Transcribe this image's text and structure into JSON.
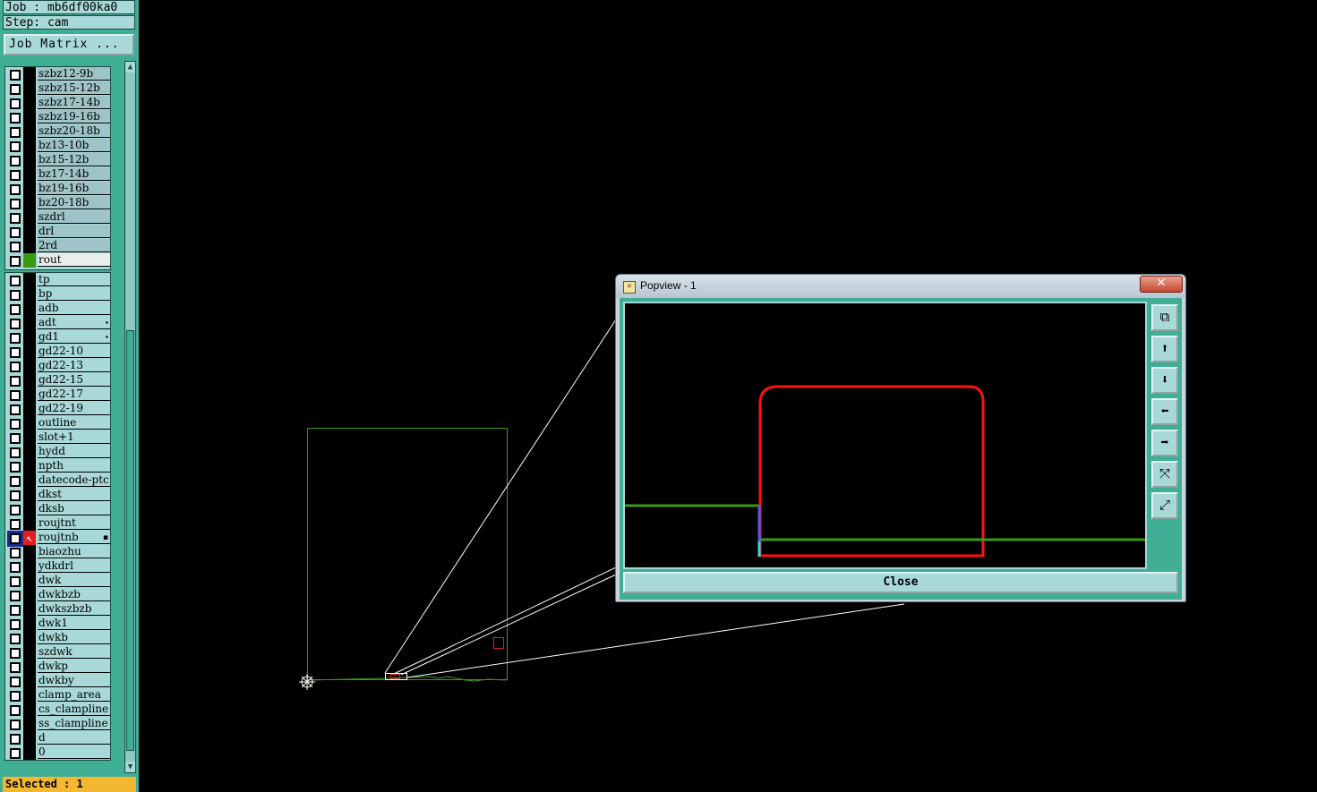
{
  "header": {
    "job": "Job : mb6df00ka0",
    "step": "Step: cam",
    "job_matrix": "Job Matrix ..."
  },
  "layers_top": [
    {
      "name": "szbz12-9b",
      "style": "grey"
    },
    {
      "name": "szbz15-12b",
      "style": "grey"
    },
    {
      "name": "szbz17-14b",
      "style": "grey"
    },
    {
      "name": "szbz19-16b",
      "style": "grey"
    },
    {
      "name": "szbz20-18b",
      "style": "grey"
    },
    {
      "name": "bz13-10b",
      "style": "grey"
    },
    {
      "name": "bz15-12b",
      "style": "grey"
    },
    {
      "name": "bz17-14b",
      "style": "grey"
    },
    {
      "name": "bz19-16b",
      "style": "grey"
    },
    {
      "name": "bz20-18b",
      "style": "grey"
    },
    {
      "name": "szdrl",
      "style": "grey"
    },
    {
      "name": "drl",
      "style": "grey"
    },
    {
      "name": "2rd",
      "style": "grey"
    },
    {
      "name": "rout",
      "style": "white",
      "color": "#3a9a10"
    }
  ],
  "layers_bottom": [
    {
      "name": "tp"
    },
    {
      "name": "bp"
    },
    {
      "name": "adb"
    },
    {
      "name": "adt",
      "mark": "⬩"
    },
    {
      "name": "gd1",
      "mark": "⬩"
    },
    {
      "name": "gd22-10"
    },
    {
      "name": "gd22-13"
    },
    {
      "name": "gd22-15"
    },
    {
      "name": "gd22-17"
    },
    {
      "name": "gd22-19"
    },
    {
      "name": "outline"
    },
    {
      "name": "slot+1"
    },
    {
      "name": "hydd"
    },
    {
      "name": "npth"
    },
    {
      "name": "datecode-ptc"
    },
    {
      "name": "dkst"
    },
    {
      "name": "dksb"
    },
    {
      "name": "roujtnt"
    },
    {
      "name": "roujtnb",
      "active": true,
      "mark": "▪"
    },
    {
      "name": "biaozhu"
    },
    {
      "name": "ydkdrl"
    },
    {
      "name": "dwk"
    },
    {
      "name": "dwkbzb"
    },
    {
      "name": "dwkszbzb"
    },
    {
      "name": "dwk1"
    },
    {
      "name": "dwkb"
    },
    {
      "name": "szdwk"
    },
    {
      "name": "dwkp"
    },
    {
      "name": "dwkby"
    },
    {
      "name": "clamp_area"
    },
    {
      "name": "cs_clampline"
    },
    {
      "name": "ss_clampline"
    },
    {
      "name": "d"
    },
    {
      "name": "0"
    }
  ],
  "status": "Selected : 1",
  "popview": {
    "title": "Popview - 1",
    "close_x": "✕",
    "close_button": "Close",
    "tools": [
      {
        "icon": "zoom-window-icon",
        "glyph": "⧉"
      },
      {
        "icon": "pan-up-icon",
        "glyph": "⬆"
      },
      {
        "icon": "pan-down-icon",
        "glyph": "⬇"
      },
      {
        "icon": "pan-left-icon",
        "glyph": "⬅"
      },
      {
        "icon": "pan-right-icon",
        "glyph": "➡"
      },
      {
        "icon": "zoom-in-icon",
        "glyph": "⤧"
      },
      {
        "icon": "zoom-out-icon",
        "glyph": "⤢"
      }
    ]
  },
  "colors": {
    "panel": "#3fae94",
    "row": "#a8d8d8",
    "rout_path": "#ff0000",
    "outline_path": "#3a9a10",
    "active_layer_color": "#e02020"
  }
}
